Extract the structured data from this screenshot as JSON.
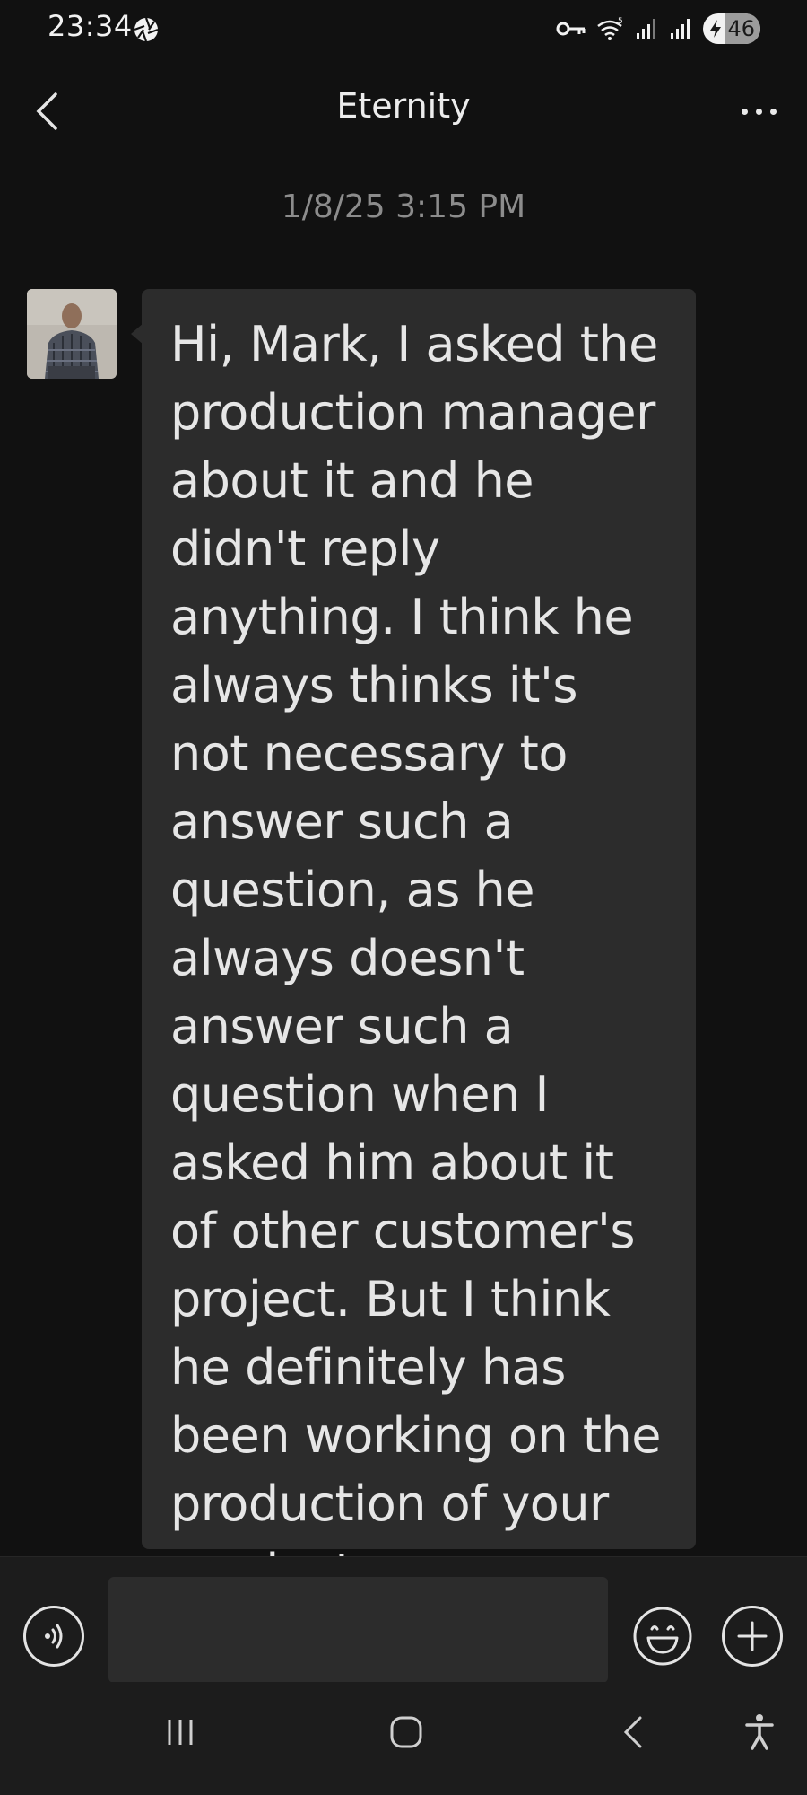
{
  "status_bar": {
    "time": "23:34",
    "battery_level": "46",
    "icons": [
      "aperture-icon",
      "vpn-key-icon",
      "wifi-icon",
      "signal-icon",
      "signal-icon",
      "battery-charging-icon"
    ]
  },
  "header": {
    "title": "Eternity",
    "back_icon": "chevron-left-icon",
    "more_icon": "more-horizontal-icon"
  },
  "conversation": {
    "timestamp": "1/8/25 3:15 PM",
    "messages": [
      {
        "sender": "other",
        "text": "Hi, Mark, I asked the production manager about it and he didn't reply anything. I think he always thinks it's not necessary to answer such a question, as he always doesn't answer such a question when I asked him about it of other customer's project. But I think he definitely has been working on the production of your products."
      }
    ]
  },
  "input_bar": {
    "value": "",
    "placeholder": "",
    "icons": [
      "voice-icon",
      "emoji-icon",
      "plus-icon"
    ]
  },
  "nav_bar": {
    "icons": [
      "recent-apps-icon",
      "home-icon",
      "back-icon",
      "accessibility-icon"
    ]
  },
  "colors": {
    "background": "#111111",
    "bubble": "#2c2c2c",
    "bar": "#1c1c1c",
    "text": "#e6e6e6",
    "muted": "#8c8c8c"
  }
}
